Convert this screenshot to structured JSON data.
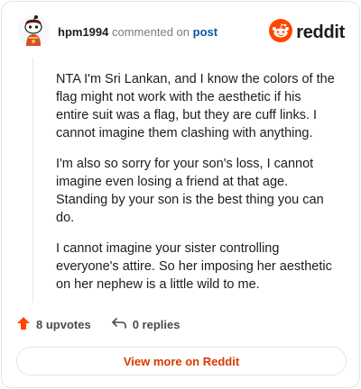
{
  "comment": {
    "username": "hpm1994",
    "verb": "commented on",
    "post_link": "post",
    "paragraphs": [
      "NTA I'm Sri Lankan, and I know the colors of the flag might not work with the aesthetic if his entire suit was a flag, but they are cuff links. I cannot imagine them clashing with anything.",
      "I'm also so sorry for your son's loss, I cannot imagine even losing a friend at that age. Standing by your son is the best thing you can do.",
      "I cannot imagine your sister controlling everyone's attire. So her imposing her aesthetic on her nephew is a little wild to me."
    ]
  },
  "brand": {
    "wordmark": "reddit",
    "icon": "reddit-logo-icon",
    "color": "#ff4500"
  },
  "avatar": {
    "icon": "snoo-avatar-icon"
  },
  "actions": {
    "upvotes": "8 upvotes",
    "replies": "0 replies",
    "upvote_icon": "upvote-arrow-icon",
    "reply_icon": "reply-arrow-icon"
  },
  "footer": {
    "view_more_label": "View more on Reddit"
  },
  "colors": {
    "accent": "#ff4500",
    "link": "#0a57a4",
    "cta": "#d93a00"
  }
}
